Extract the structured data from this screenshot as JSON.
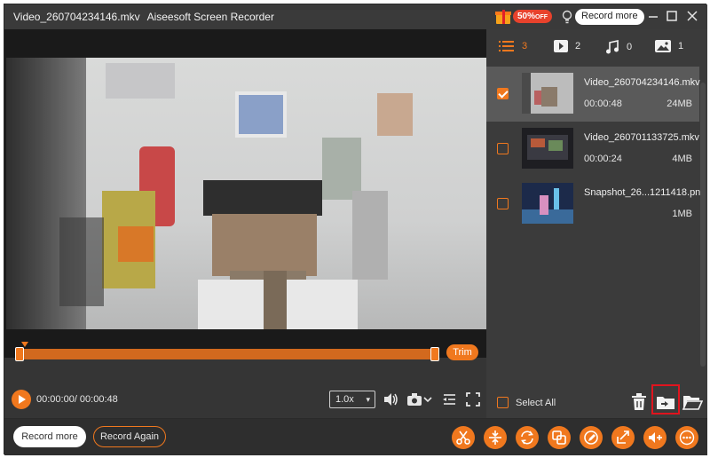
{
  "titlebar": {
    "file_name": "Video_260704234146.mkv",
    "app_name": "Aiseesoft Screen Recorder",
    "promo_percent": "50%",
    "promo_off": "OFF",
    "record_more_label": "Record more"
  },
  "filter_tabs": [
    {
      "icon": "list-icon",
      "count": "3"
    },
    {
      "icon": "video-icon",
      "count": "2"
    },
    {
      "icon": "music-icon",
      "count": "0"
    },
    {
      "icon": "image-icon",
      "count": "1"
    }
  ],
  "files": [
    {
      "name": "Video_260704234146.mkv",
      "duration": "00:00:48",
      "size": "24MB",
      "selected": true
    },
    {
      "name": "Video_260701133725.mkv",
      "duration": "00:00:24",
      "size": "4MB",
      "selected": false
    },
    {
      "name": "Snapshot_26...1211418.png",
      "duration": "",
      "size": "1MB",
      "selected": false
    }
  ],
  "player": {
    "time": "00:00:00/ 00:00:48",
    "speed": "1.0x",
    "trim_label": "Trim"
  },
  "sidepanel": {
    "select_all_label": "Select All"
  },
  "bottombar": {
    "record_more_label": "Record more",
    "record_again_label": "Record Again"
  },
  "colors": {
    "accent": "#f0781e",
    "panel_bg": "#3b3b3b",
    "highlight_box": "#e0141e"
  }
}
